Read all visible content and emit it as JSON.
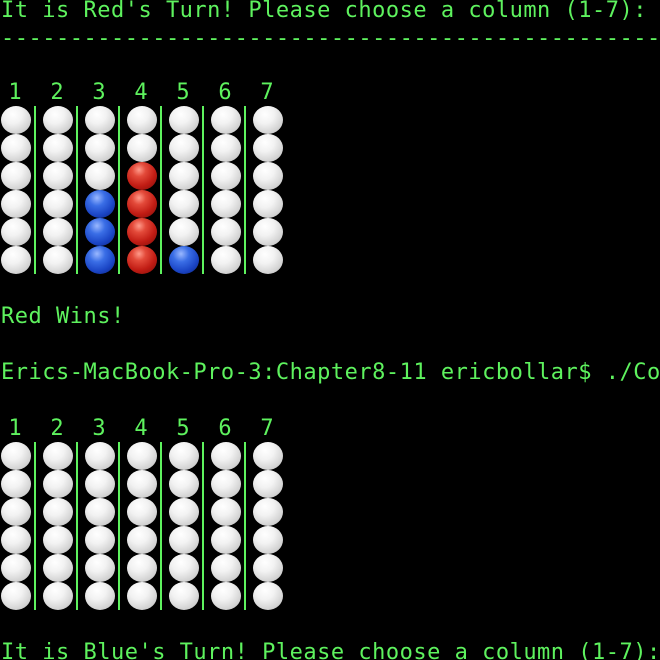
{
  "terminal": {
    "line_turn_red": "It is Red's Turn! Please choose a column (1-7):",
    "divider": "---------------------------------------------------------",
    "line_red_wins": "Red Wins!",
    "prompt": "Erics-MacBook-Pro-3:Chapter8-11 ericbollar$ ./Co",
    "line_turn_blue": "It is Blue's Turn! Please choose a column (1-7):"
  },
  "board_labels": [
    "1",
    "2",
    "3",
    "4",
    "5",
    "6",
    "7"
  ],
  "boards": [
    {
      "name": "board-1",
      "columns": [
        [
          "empty",
          "empty",
          "empty",
          "empty",
          "empty",
          "empty"
        ],
        [
          "empty",
          "empty",
          "empty",
          "empty",
          "empty",
          "empty"
        ],
        [
          "empty",
          "empty",
          "empty",
          "blue",
          "blue",
          "blue"
        ],
        [
          "empty",
          "empty",
          "red",
          "red",
          "red",
          "red"
        ],
        [
          "empty",
          "empty",
          "empty",
          "empty",
          "empty",
          "blue"
        ],
        [
          "empty",
          "empty",
          "empty",
          "empty",
          "empty",
          "empty"
        ],
        [
          "empty",
          "empty",
          "empty",
          "empty",
          "empty",
          "empty"
        ]
      ]
    },
    {
      "name": "board-2",
      "columns": [
        [
          "empty",
          "empty",
          "empty",
          "empty",
          "empty",
          "empty"
        ],
        [
          "empty",
          "empty",
          "empty",
          "empty",
          "empty",
          "empty"
        ],
        [
          "empty",
          "empty",
          "empty",
          "empty",
          "empty",
          "empty"
        ],
        [
          "empty",
          "empty",
          "empty",
          "empty",
          "empty",
          "empty"
        ],
        [
          "empty",
          "empty",
          "empty",
          "empty",
          "empty",
          "empty"
        ],
        [
          "empty",
          "empty",
          "empty",
          "empty",
          "empty",
          "empty"
        ],
        [
          "empty",
          "empty",
          "empty",
          "empty",
          "empty",
          "empty"
        ]
      ]
    }
  ]
}
